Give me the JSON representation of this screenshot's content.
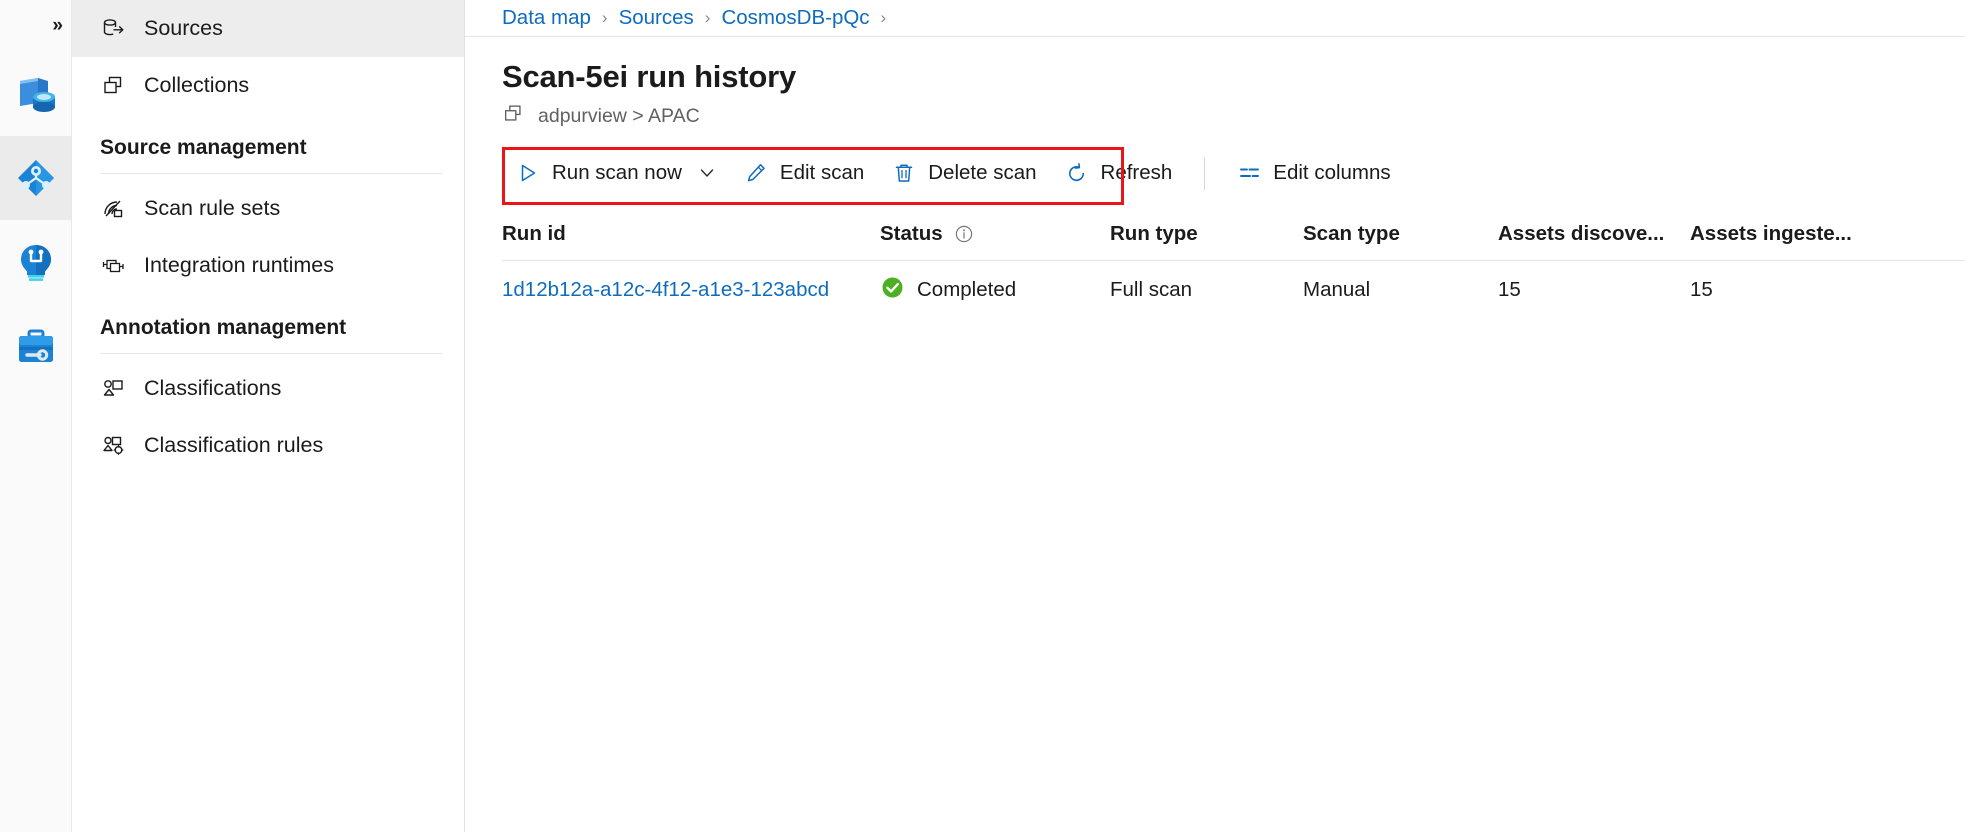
{
  "rail": {
    "expand_label": "»",
    "items": [
      {
        "name": "data-catalog-icon",
        "title": "Data catalog"
      },
      {
        "name": "data-map-icon",
        "title": "Data map"
      },
      {
        "name": "data-insights-icon",
        "title": "Data insights"
      },
      {
        "name": "management-icon",
        "title": "Management"
      }
    ]
  },
  "nav": {
    "items": [
      {
        "label": "Sources",
        "icon": "sources-icon",
        "selected": true
      },
      {
        "label": "Collections",
        "icon": "collections-icon",
        "selected": false
      }
    ],
    "groups": [
      {
        "title": "Source management",
        "items": [
          {
            "label": "Scan rule sets",
            "icon": "scan-rule-sets-icon"
          },
          {
            "label": "Integration runtimes",
            "icon": "integration-runtimes-icon"
          }
        ]
      },
      {
        "title": "Annotation management",
        "items": [
          {
            "label": "Classifications",
            "icon": "classifications-icon"
          },
          {
            "label": "Classification rules",
            "icon": "classification-rules-icon"
          }
        ]
      }
    ]
  },
  "breadcrumb": {
    "separator": "›",
    "items": [
      "Data map",
      "Sources",
      "CosmosDB-pQc"
    ]
  },
  "page": {
    "title": "Scan-5ei run history",
    "collection_path": "adpurview > APAC",
    "collection_icon": "collections-icon"
  },
  "toolbar": {
    "run_scan_now": "Run scan now",
    "run_scan_now_icon": "play-icon",
    "run_scan_now_caret_icon": "chevron-down-icon",
    "edit_scan": "Edit scan",
    "edit_scan_icon": "pencil-icon",
    "delete_scan": "Delete scan",
    "delete_scan_icon": "trash-icon",
    "refresh": "Refresh",
    "refresh_icon": "refresh-icon",
    "edit_columns": "Edit columns",
    "edit_columns_icon": "edit-columns-icon",
    "highlight_color": "#e8161a"
  },
  "table": {
    "columns": [
      "Run id",
      "Status",
      "Run type",
      "Scan type",
      "Assets discove...",
      "Assets ingeste..."
    ],
    "status_info_icon": "info-icon",
    "rows": [
      {
        "run_id": "1d12b12a-a12c-4f12-a1e3-123abcd",
        "status": "Completed",
        "status_icon": "success-check-icon",
        "status_color": "#4caf24",
        "run_type": "Full scan",
        "scan_type": "Manual",
        "assets_discovered": "15",
        "assets_ingested": "15"
      }
    ]
  },
  "colors": {
    "link": "#0f6cbd",
    "nav_selected_bg": "#ededed",
    "rail_active_bg": "#ebebeb",
    "success": "#4caf24",
    "annotation_red": "#e8161a"
  }
}
